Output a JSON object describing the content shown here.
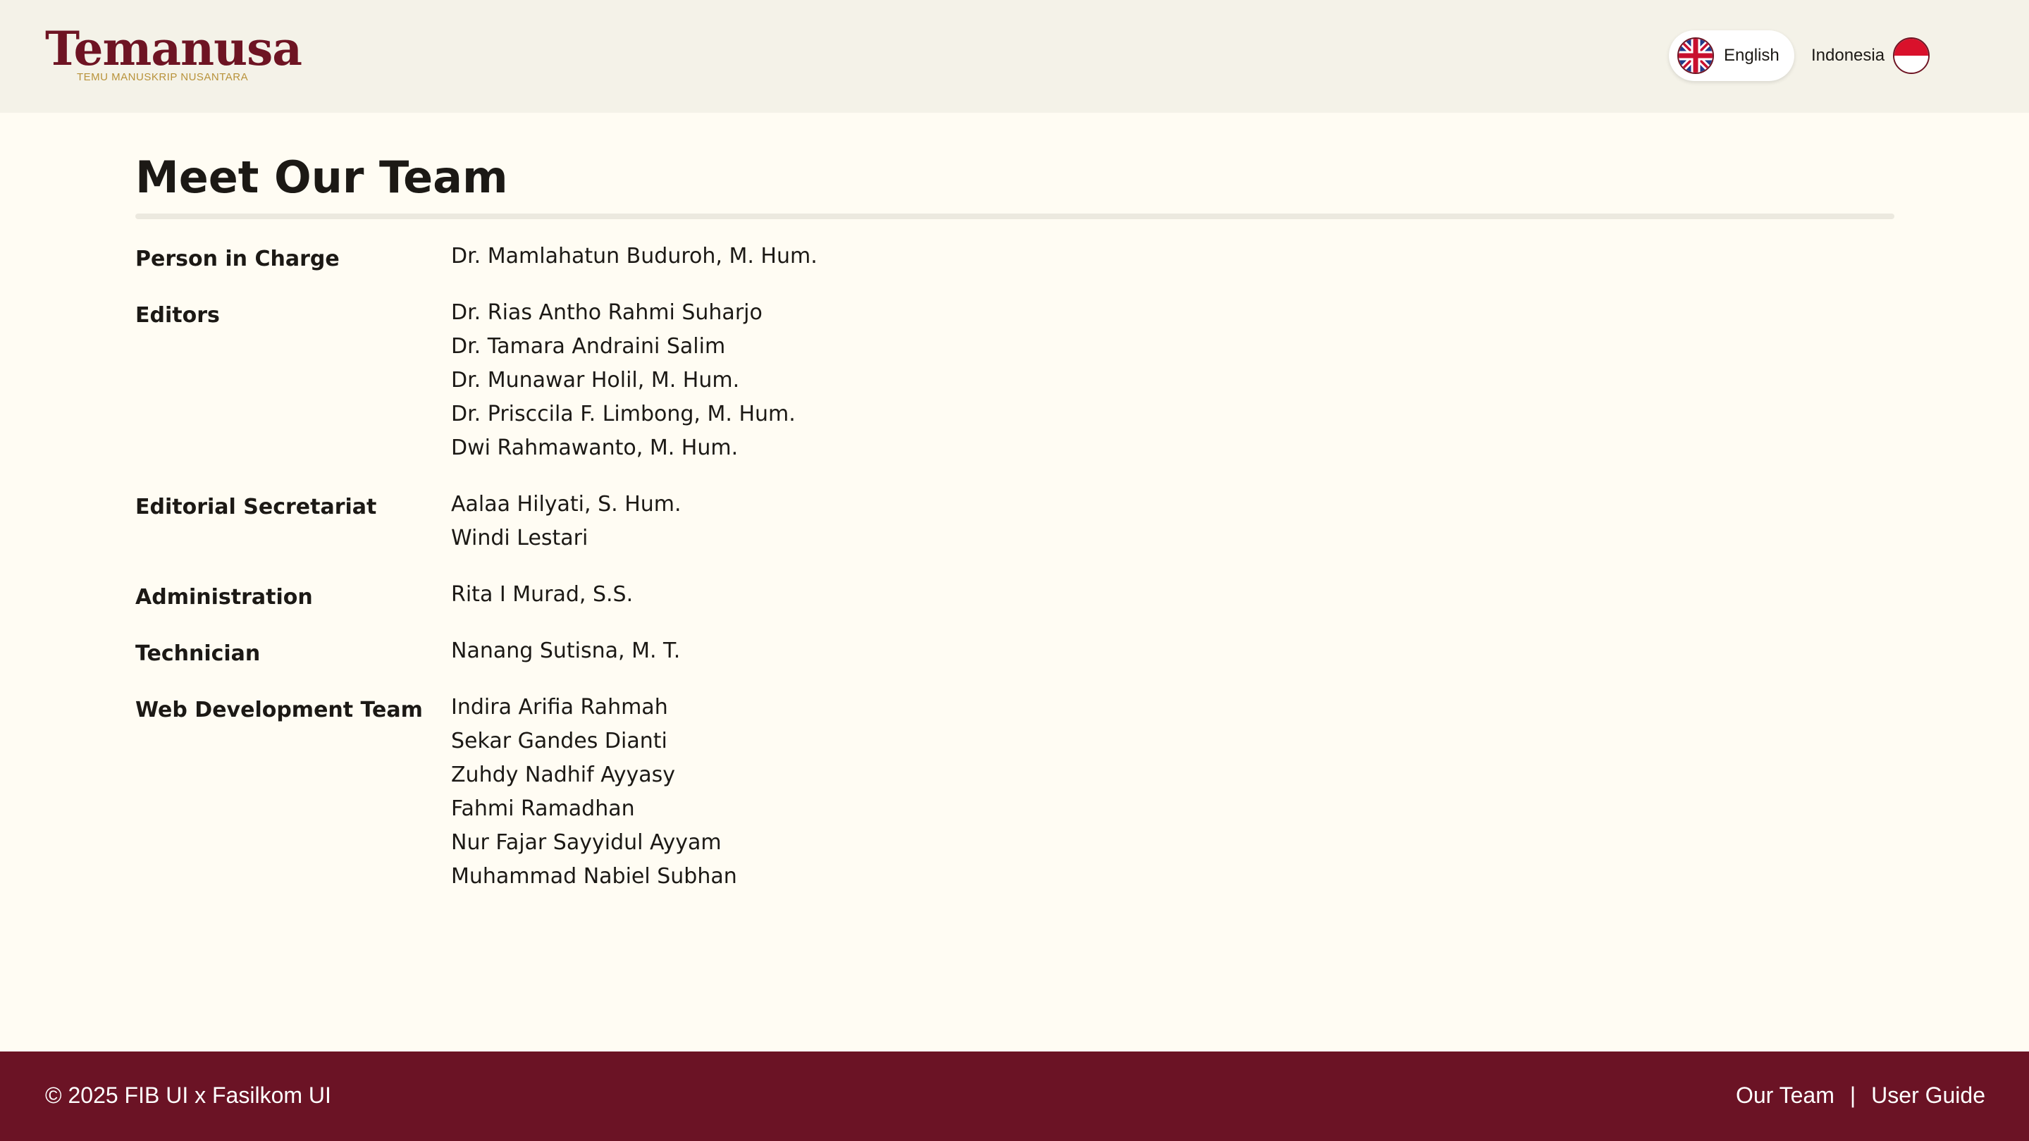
{
  "header": {
    "logo_text": "Temanusa",
    "logo_tagline": "TEMU MANUSKRIP NUSANTARA",
    "languages": {
      "english": "English",
      "indonesia": "Indonesia"
    }
  },
  "main": {
    "title": "Meet Our Team",
    "roles": [
      {
        "label": "Person in Charge",
        "members": [
          "Dr. Mamlahatun Buduroh, M. Hum."
        ]
      },
      {
        "label": "Editors",
        "members": [
          "Dr. Rias Antho Rahmi Suharjo",
          "Dr. Tamara Andraini Salim",
          "Dr. Munawar Holil, M. Hum.",
          "Dr. Prisccila F. Limbong, M. Hum.",
          "Dwi Rahmawanto, M. Hum."
        ]
      },
      {
        "label": "Editorial Secretariat",
        "members": [
          "Aalaa Hilyati, S. Hum.",
          "Windi Lestari"
        ]
      },
      {
        "label": "Administration",
        "members": [
          "Rita I Murad, S.S."
        ]
      },
      {
        "label": "Technician",
        "members": [
          "Nanang Sutisna, M. T."
        ]
      },
      {
        "label": "Web Development Team",
        "members": [
          "Indira Arifia Rahmah",
          "Sekar Gandes Dianti",
          "Zuhdy Nadhif Ayyasy",
          "Fahmi Ramadhan",
          "Nur Fajar Sayyidul Ayyam",
          "Muhammad Nabiel Subhan"
        ]
      }
    ]
  },
  "footer": {
    "copyright": "© 2025 FIB UI x Fasilkom UI",
    "links": {
      "our_team": "Our Team",
      "separator": "|",
      "user_guide": "User Guide"
    }
  },
  "colors": {
    "brand": "#6e1423",
    "footer_bg": "#6b1325",
    "page_bg": "#fffcf3",
    "header_bg": "#f4f2e8",
    "tagline": "#b8923a"
  },
  "icons": {
    "english": "uk-flag-icon",
    "indonesia": "indonesia-flag-icon"
  }
}
